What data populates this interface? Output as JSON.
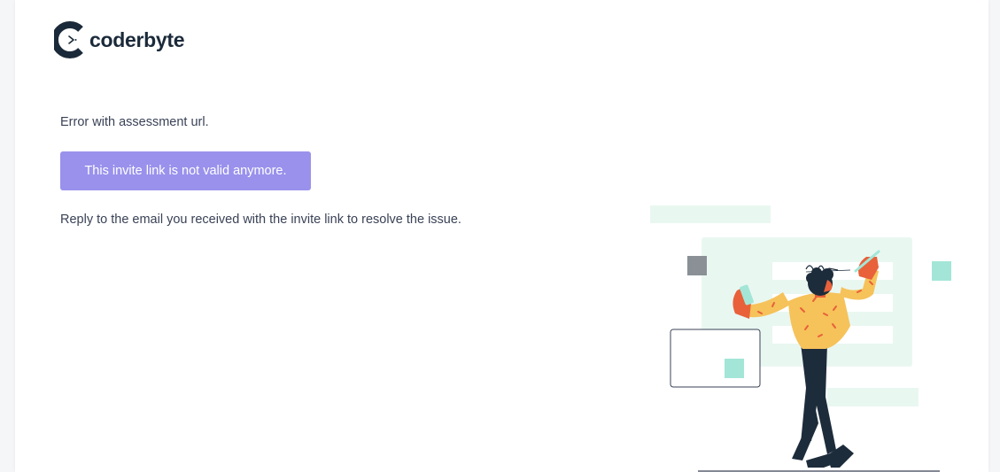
{
  "brand": {
    "name": "coderbyte",
    "logo_icon": "coderbyte-logo-icon",
    "text_color": "#1b2a3a"
  },
  "message": {
    "error_title": "Error with assessment url.",
    "invite_button_label": "This invite link is not valid anymore.",
    "reply_instruction": "Reply to the email you received with the invite link to resolve the issue."
  },
  "colors": {
    "button_bg": "#9991ec",
    "text": "#3a4256",
    "page_bg": "#f5f6f8",
    "accent_mint": "#a3e6d7",
    "illustration_bg": "#e9f7f1",
    "shirt": "#f6c25a",
    "skin": "#e8613a",
    "pants": "#1d2c3b"
  },
  "illustration": {
    "icon": "person-writing-illustration"
  }
}
